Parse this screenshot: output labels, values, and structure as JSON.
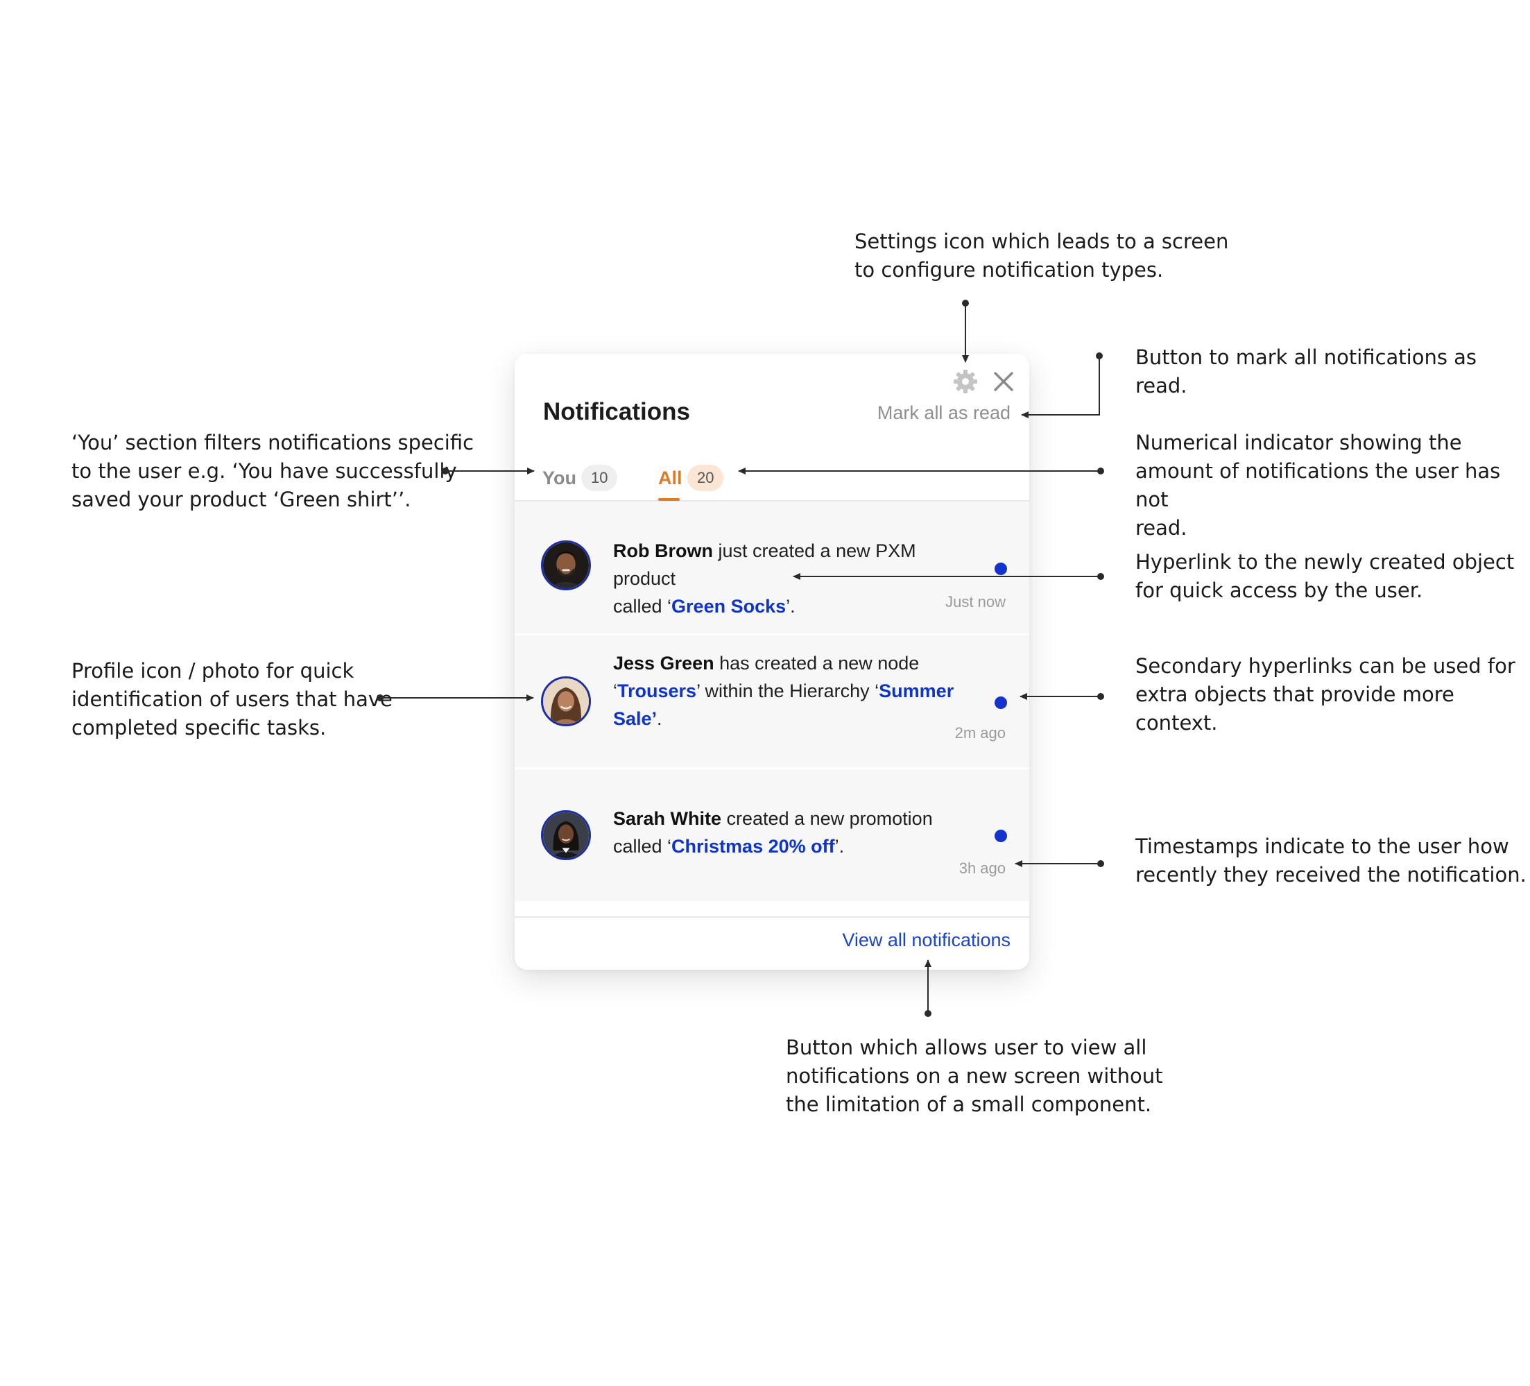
{
  "panel": {
    "title": "Notifications",
    "mark_all_label": "Mark all as read",
    "settings_icon": "gear-icon",
    "close_icon": "close-icon",
    "tabs": [
      {
        "label": "You",
        "count": "10",
        "selected": false
      },
      {
        "label": "All",
        "count": "20",
        "selected": true
      }
    ],
    "items": [
      {
        "actor": "Rob Brown",
        "line1_rest": " just created a new PXM product",
        "line2_pre": "called ‘",
        "link1": "Green Socks",
        "line2_post": "’.",
        "time": "Just now",
        "unread": true
      },
      {
        "actor": "Jess Green",
        "line1_rest": " has created a new node",
        "line2_pre": "‘",
        "link1": "Trousers",
        "mid": "’ within the Hierarchy ‘",
        "link2a": "Summer",
        "link2b": "Sale’",
        "line3_post": ".",
        "time": "2m ago",
        "unread": true
      },
      {
        "actor": "Sarah White",
        "line1_rest": " created a new promotion",
        "line2_pre": "called ‘",
        "link1": "Christmas 20% off",
        "line2_post": "’.",
        "time": "3h ago",
        "unread": true
      }
    ],
    "view_all_label": "View all notifications",
    "colors": {
      "accent_tab": "#e07a24",
      "link": "#0f34c9",
      "unread_dot": "#1433cc"
    }
  },
  "annotations": {
    "settings": {
      "line1": "Settings icon which leads to a screen",
      "line2": "to configure notification types."
    },
    "mark_read": {
      "line1": "Button to mark all notifications as read."
    },
    "you_section": {
      "line1": "‘You’ section filters notifications specific",
      "line2": "to the user e.g. ‘You have successfully",
      "line3": "saved your product ‘Green shirt’’."
    },
    "counter": {
      "line1": "Numerical indicator showing the",
      "line2": "amount of notifications the user has not",
      "line3": "read."
    },
    "hyperlink": {
      "line1": "Hyperlink to the newly created object",
      "line2": "for quick access by the user."
    },
    "profile": {
      "line1": "Profile icon / photo for quick",
      "line2": "identification of users that have",
      "line3": "completed specific tasks."
    },
    "secondary": {
      "line1": "Secondary hyperlinks can be used for",
      "line2": "extra objects that provide more",
      "line3": "context."
    },
    "timestamps": {
      "line1": "Timestamps indicate to the user how",
      "line2": "recently they received the notification."
    },
    "view_all": {
      "line1": "Button which allows user to view all",
      "line2": "notifications on a new screen without",
      "line3": "the limitation of a small component."
    }
  }
}
